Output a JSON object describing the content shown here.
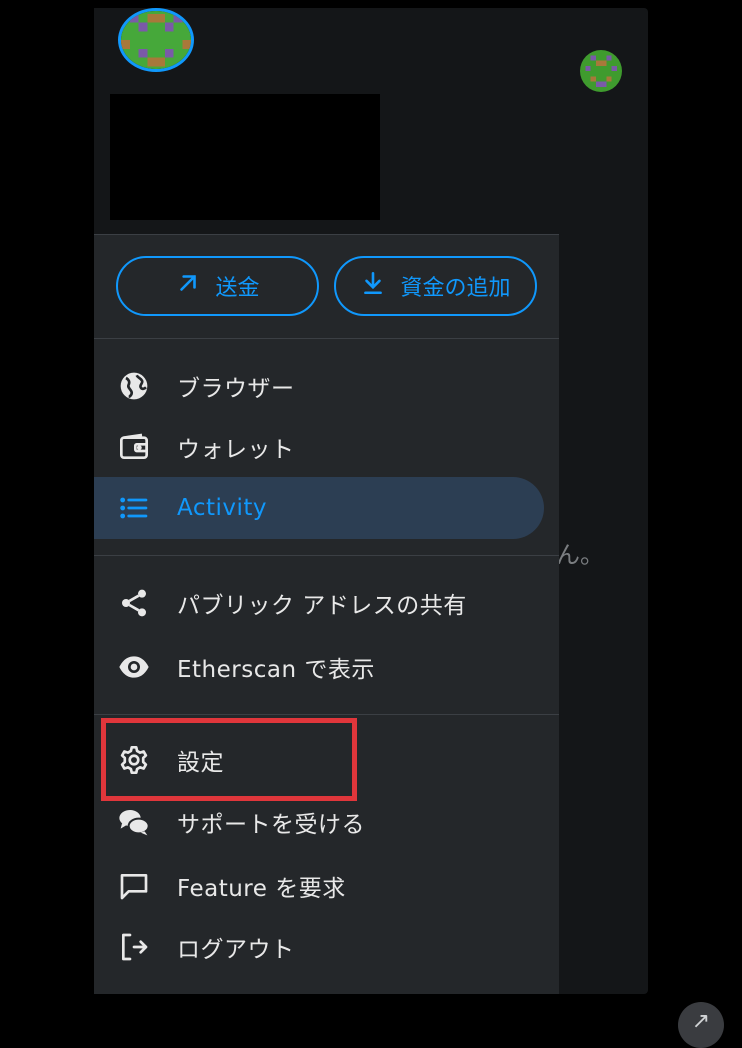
{
  "actions": {
    "send_label": "送金",
    "add_funds_label": "資金の追加"
  },
  "menu": {
    "browser": "ブラウザー",
    "wallet": "ウォレット",
    "activity": "Activity",
    "share_address": "パブリック アドレスの共有",
    "etherscan": "Etherscan で表示",
    "settings": "設定",
    "support": "サポートを受ける",
    "feature_request": "Feature を要求",
    "logout": "ログアウト"
  },
  "background": {
    "partial_text": "ん。"
  },
  "colors": {
    "accent": "#1098fc",
    "drawer_bg": "#24272a",
    "header_bg": "#141618",
    "active_bg": "#2c3e53",
    "highlight": "#e0363b"
  },
  "icons": {
    "send": "arrow-up-right-icon",
    "add_funds": "download-icon",
    "browser": "globe-icon",
    "wallet": "wallet-icon",
    "activity": "list-icon",
    "share": "share-icon",
    "etherscan": "eye-icon",
    "settings": "gear-icon",
    "support": "chat-bubbles-icon",
    "feature": "message-square-icon",
    "logout": "logout-icon"
  }
}
